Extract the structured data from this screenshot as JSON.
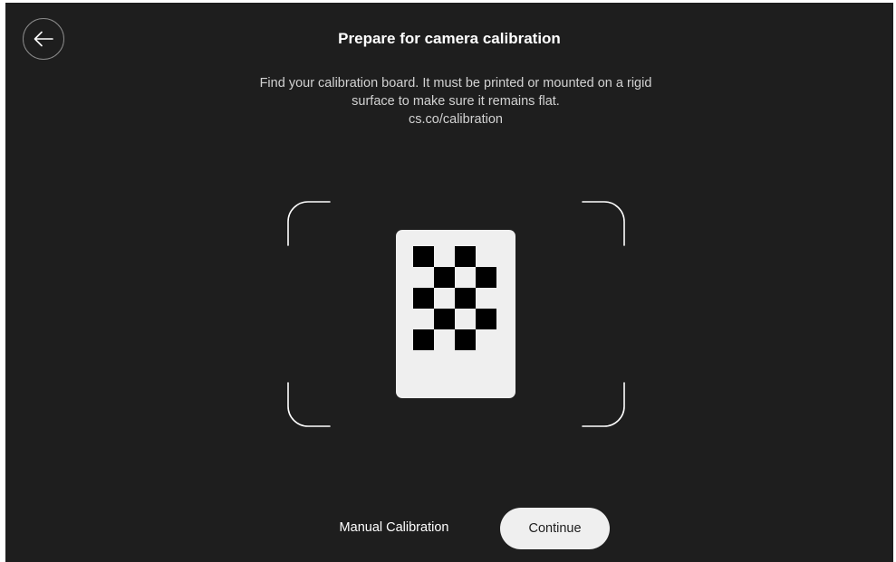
{
  "header": {
    "back_icon": "arrow-left-icon",
    "title": "Prepare for camera calibration"
  },
  "instructions": {
    "line1": "Find your calibration board. It must be printed or mounted on a rigid",
    "line2": "surface to make sure it remains flat.",
    "link": "cs.co/calibration"
  },
  "illustration": {
    "frame_icon": "viewfinder-corners-icon",
    "board_icon": "checkerboard-icon",
    "frame_color": "#ffffff",
    "board_color": "#efefef",
    "square_color": "#000000"
  },
  "footer": {
    "manual_label": "Manual Calibration",
    "continue_label": "Continue"
  },
  "colors": {
    "background": "#1e1e1e",
    "text_primary": "#ffffff",
    "text_secondary": "#d2d2d2",
    "button_bg": "#efefef"
  }
}
